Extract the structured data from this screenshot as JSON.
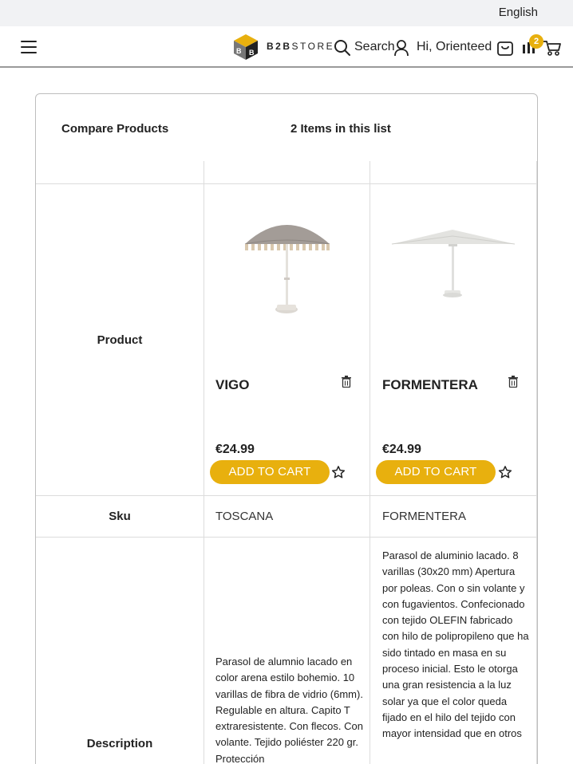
{
  "topbar": {
    "language": "English"
  },
  "header": {
    "brand_bold": "B2B",
    "brand_rest": "STORE",
    "search_label": "Search",
    "greeting": "Hi, Orienteed",
    "compare_count": "2"
  },
  "compare": {
    "title": "Compare Products",
    "count_text": "2 Items in this list",
    "row_labels": {
      "product": "Product",
      "sku": "Sku",
      "description": "Description"
    },
    "products": [
      {
        "name": "VIGO",
        "price": "€24.99",
        "add_to_cart": "ADD TO CART",
        "sku": "TOSCANA",
        "description": "Parasol de alumnio lacado en color arena estilo bohemio. 10 varillas de fibra de vidrio (6mm). Regulable en altura. Capito T extraresistente. Con flecos. Con volante. Tejido poliéster 220 gr. Protección"
      },
      {
        "name": "FORMENTERA",
        "price": "€24.99",
        "add_to_cart": "ADD TO CART",
        "sku": "FORMENTERA",
        "description": "Parasol de aluminio lacado. 8 varillas (30x20 mm) Apertura por poleas. Con o sin volante y con fugavientos. Confecionado con tejido OLEFIN fabricado con hilo de polipropileno que ha sido tintado en masa en su proceso inicial. Esto le otorga una gran resistencia a la luz solar ya que el color queda fijado en el hilo del tejido con mayor intensidad que en otros"
      }
    ]
  },
  "colors": {
    "accent": "#e8b00e",
    "topbar_bg": "#f1f2f4",
    "border": "#bdbdbd"
  }
}
